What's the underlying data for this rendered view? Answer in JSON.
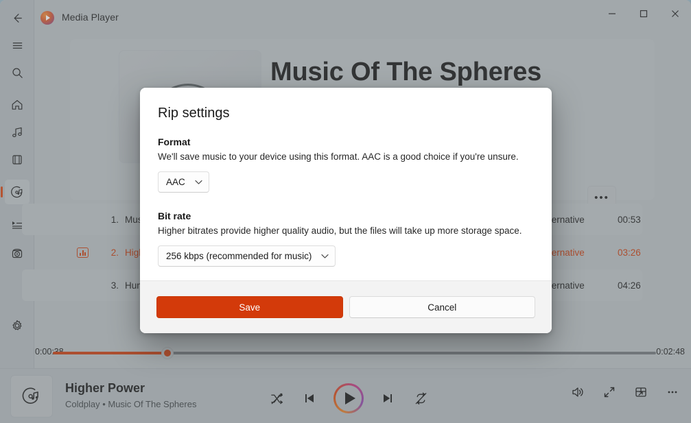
{
  "window": {
    "app_title": "Media Player",
    "app_icon": "media-player-icon",
    "controls": {
      "minimize": "—",
      "maximize": "☐",
      "close": "✕"
    }
  },
  "rail": {
    "back_icon": "back-arrow-icon",
    "menu_icon": "hamburger-menu-icon",
    "search_icon": "search-icon",
    "items": [
      {
        "name": "home",
        "icon": "home-icon",
        "selected": false
      },
      {
        "name": "music-library",
        "icon": "music-note-icon",
        "selected": false
      },
      {
        "name": "video-library",
        "icon": "film-strip-icon",
        "selected": false
      },
      {
        "name": "play-cd",
        "icon": "cd-music-icon",
        "selected": true
      },
      {
        "name": "play-queue",
        "icon": "playlist-icon",
        "selected": false
      },
      {
        "name": "burn-disc",
        "icon": "disc-burn-icon",
        "selected": false
      }
    ],
    "settings": {
      "name": "settings",
      "icon": "gear-icon"
    }
  },
  "album": {
    "title": "Music Of The Spheres",
    "art_icon": "album-disc-placeholder",
    "more_label": "•••"
  },
  "tracks": {
    "rows": [
      {
        "number": "1.",
        "title": "Music Of The Spheres",
        "genre": "Alternative",
        "duration": "00:53",
        "playing": false
      },
      {
        "number": "2.",
        "title": "Higher Power",
        "genre": "Alternative",
        "duration": "03:26",
        "playing": true
      },
      {
        "number": "3.",
        "title": "Humankind",
        "genre": "Alternative",
        "duration": "04:26",
        "playing": false
      }
    ]
  },
  "seek": {
    "elapsed": "0:00:38",
    "total": "0:02:48",
    "percent": 19
  },
  "now_playing": {
    "art_icon": "cd-music-icon",
    "title": "Higher Power",
    "subtitle": "Coldplay • Music Of The Spheres",
    "shuffle_icon": "shuffle-off-icon",
    "previous_icon": "previous-track-icon",
    "play_icon": "play-icon",
    "next_icon": "next-track-icon",
    "repeat_icon": "repeat-off-icon",
    "volume_icon": "volume-icon",
    "fullscreen_icon": "expand-icon",
    "miniplayer_icon": "mini-player-icon",
    "more_icon": "more-options-icon"
  },
  "dialog": {
    "title": "Rip settings",
    "format": {
      "label": "Format",
      "description": "We'll save music to your device using this format. AAC is a good choice if you're unsure.",
      "value": "AAC",
      "chevron": "⌄"
    },
    "bitrate": {
      "label": "Bit rate",
      "description": "Higher bitrates provide higher quality audio, but the files will take up more storage space.",
      "value": "256 kbps (recommended for music)",
      "chevron": "⌄"
    },
    "save_label": "Save",
    "cancel_label": "Cancel"
  },
  "colors": {
    "accent": "#d33a0a",
    "playing": "#c4390a",
    "window_bg": "#b6bbbe"
  }
}
